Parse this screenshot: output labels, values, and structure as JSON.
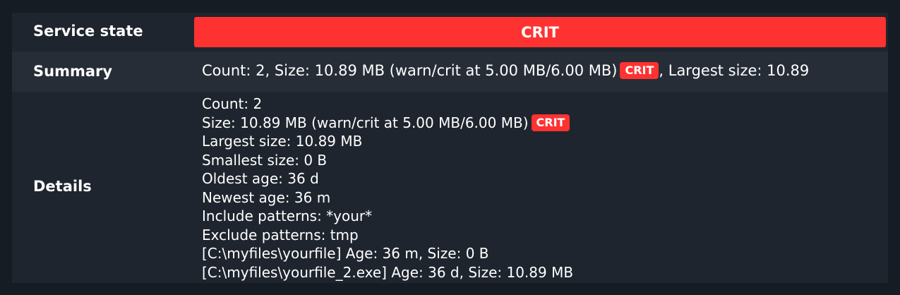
{
  "service_state": {
    "label": "Service state",
    "value": "CRIT",
    "color": "#ff3232"
  },
  "summary": {
    "label": "Summary",
    "text_before": "Count: 2, Size: 10.89 MB (warn/crit at 5.00 MB/6.00 MB)",
    "badge": "CRIT",
    "text_after": ", Largest size: 10.89"
  },
  "details": {
    "label": "Details",
    "lines": [
      {
        "text": "Count: 2"
      },
      {
        "text": "Size: 10.89 MB (warn/crit at 5.00 MB/6.00 MB)",
        "badge": "CRIT"
      },
      {
        "text": "Largest size: 10.89 MB"
      },
      {
        "text": "Smallest size: 0 B"
      },
      {
        "text": "Oldest age: 36 d"
      },
      {
        "text": "Newest age: 36 m"
      },
      {
        "text": "Include patterns: *your*"
      },
      {
        "text": "Exclude patterns: tmp"
      },
      {
        "text": "[C:\\myfiles\\yourfile] Age: 36 m, Size: 0 B"
      },
      {
        "text": "[C:\\myfiles\\yourfile_2.exe] Age: 36 d, Size: 10.89 MB"
      }
    ]
  },
  "colors": {
    "background": "#161c24",
    "panel": "#1f252e",
    "row_alt": "#262d37",
    "crit": "#ff3232"
  }
}
